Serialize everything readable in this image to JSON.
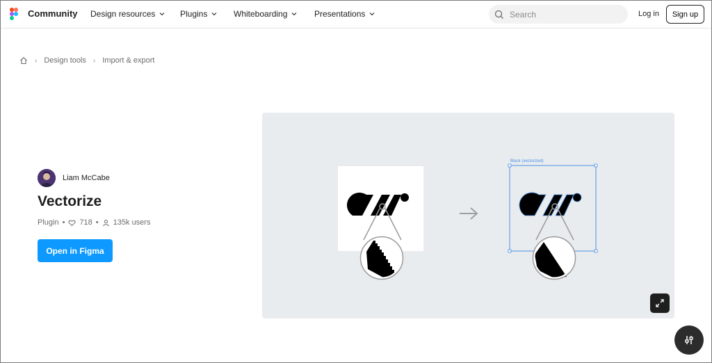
{
  "nav": {
    "brand": "Community",
    "items": [
      {
        "label": "Design resources"
      },
      {
        "label": "Plugins"
      },
      {
        "label": "Whiteboarding"
      },
      {
        "label": "Presentations"
      }
    ],
    "search_placeholder": "Search",
    "login_label": "Log in",
    "signup_label": "Sign up"
  },
  "breadcrumb": {
    "items": [
      "Design tools",
      "Import & export"
    ]
  },
  "plugin": {
    "author": "Liam McCabe",
    "title": "Vectorize",
    "type": "Plugin",
    "likes": "718",
    "users": "135k users",
    "open_label": "Open in Figma"
  },
  "preview": {
    "selection_label": "Black (vectorized)"
  },
  "colors": {
    "accent": "#0d99ff",
    "preview_bg": "#e9ecef",
    "selection": "#4a90e2"
  }
}
